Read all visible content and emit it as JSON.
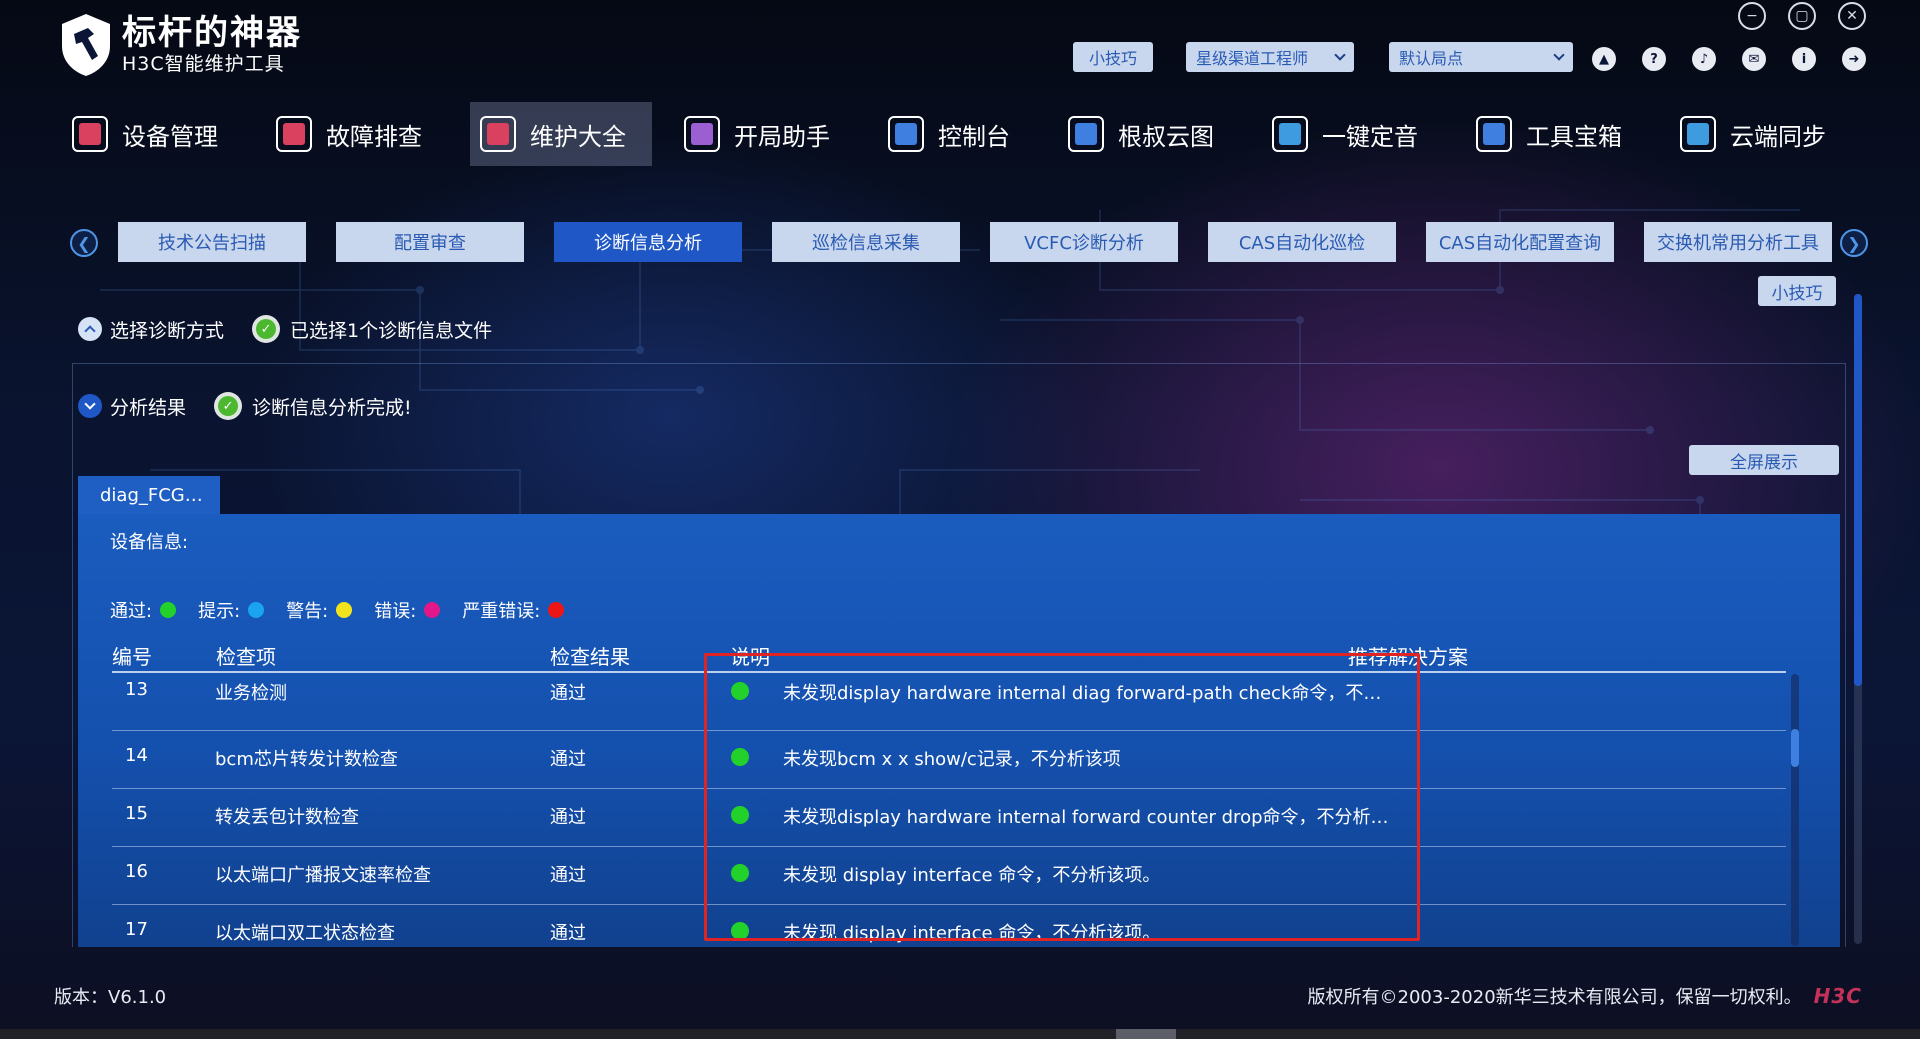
{
  "app": {
    "logo_title": "标杆的神器",
    "logo_subtitle": "H3C智能维护工具"
  },
  "header": {
    "tip_label": "小技巧",
    "role_select": "星级渠道工程师",
    "site_select": "默认局点"
  },
  "main_nav": [
    {
      "label": "设备管理",
      "color": "#d9415f"
    },
    {
      "label": "故障排查",
      "color": "#d9415f"
    },
    {
      "label": "维护大全",
      "color": "#d9415f"
    },
    {
      "label": "开局助手",
      "color": "#9b5fd1"
    },
    {
      "label": "控制台",
      "color": "#3f7fe0"
    },
    {
      "label": "根叔云图",
      "color": "#3f7fe0"
    },
    {
      "label": "一键定音",
      "color": "#3f9be0"
    },
    {
      "label": "工具宝箱",
      "color": "#3f7fe0"
    },
    {
      "label": "云端同步",
      "color": "#3f9be0"
    }
  ],
  "sub_nav": [
    "技术公告扫描",
    "配置审查",
    "诊断信息分析",
    "巡检信息采集",
    "VCFC诊断分析",
    "CAS自动化巡检",
    "CAS自动化配置查询",
    "交换机常用分析工具"
  ],
  "right_tip_label": "小技巧",
  "steps": {
    "step1_label": "选择诊断方式",
    "step1_status": "已选择1个诊断信息文件",
    "step2_label": "分析结果",
    "step2_status": "诊断信息分析完成!"
  },
  "panel": {
    "fullscreen_label": "全屏展示",
    "file_tab": "diag_FCG…",
    "device_info_label": "设备信息:"
  },
  "legend": [
    {
      "label": "通过:",
      "color": "#22d12a"
    },
    {
      "label": "提示:",
      "color": "#1aa3f0"
    },
    {
      "label": "警告:",
      "color": "#f2e41c"
    },
    {
      "label": "错误:",
      "color": "#e2178a"
    },
    {
      "label": "严重错误:",
      "color": "#ee1515"
    }
  ],
  "table": {
    "headers": [
      "编号",
      "检查项",
      "检查结果",
      "说明",
      "推荐解决方案"
    ],
    "rows": [
      {
        "id": "13",
        "item": "业务检测",
        "result": "通过",
        "desc": "未发现display hardware internal diag forward-path check命令，不…"
      },
      {
        "id": "14",
        "item": "bcm芯片转发计数检查",
        "result": "通过",
        "desc": "未发现bcm x x show/c记录，不分析该项"
      },
      {
        "id": "15",
        "item": "转发丢包计数检查",
        "result": "通过",
        "desc": "未发现display hardware internal forward counter drop命令，不分析…"
      },
      {
        "id": "16",
        "item": "以太端口广播报文速率检查",
        "result": "通过",
        "desc": "未发现 display interface 命令，不分析该项。"
      },
      {
        "id": "17",
        "item": "以太端口双工状态检查",
        "result": "通过",
        "desc": "未发现 display interface 命令，不分析该项。"
      }
    ]
  },
  "footer": {
    "version": "版本：V6.1.0",
    "copyright": "版权所有©2003-2020新华三技术有限公司，保留一切权利。",
    "brand": "H3C"
  }
}
